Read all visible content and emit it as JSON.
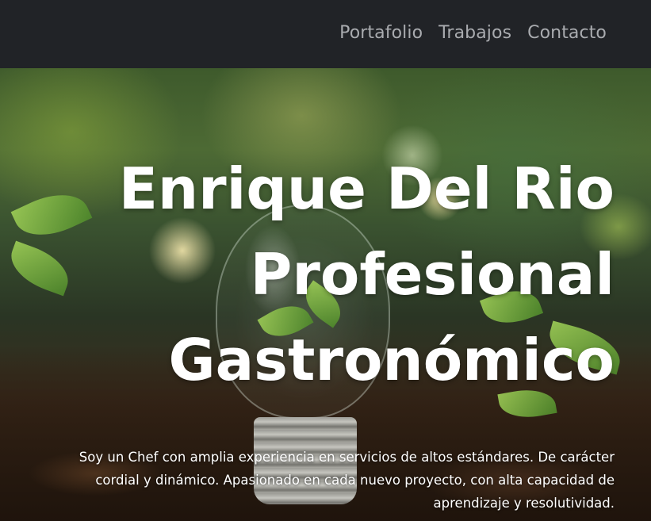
{
  "nav": {
    "items": [
      {
        "label": "Portafolio"
      },
      {
        "label": "Trabajos"
      },
      {
        "label": "Contacto"
      }
    ]
  },
  "hero": {
    "title_lines": [
      "Enrique Del Rio",
      "Profesional",
      "Gastronómico"
    ],
    "description": "Soy un Chef con amplia experiencia en servicios de altos estándares. De carácter cordial y dinámico. Apasionado en cada nuevo proyecto, con alta capacidad de aprendizaje y resolutividad.",
    "background_image": "lightbulb-sprout-icon"
  },
  "colors": {
    "navbar_bg": "#212327",
    "nav_link": "#a9abaf",
    "hero_text": "#ffffff"
  }
}
